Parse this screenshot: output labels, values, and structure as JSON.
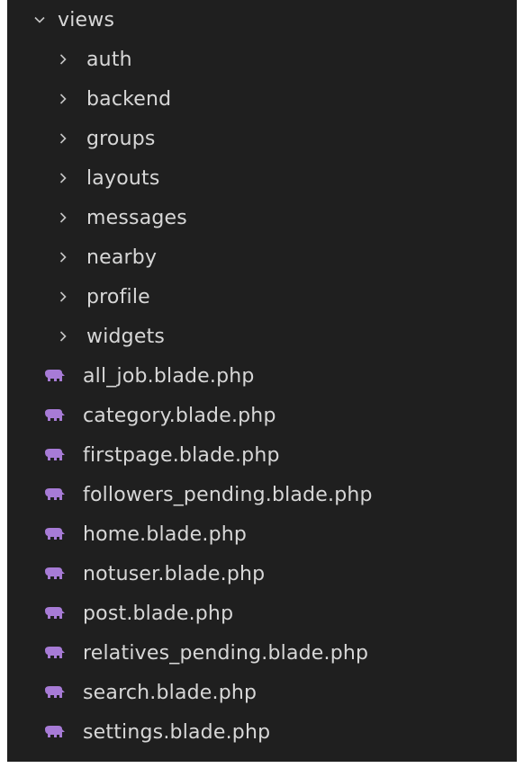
{
  "explorer": {
    "root_folder": {
      "label": "views",
      "icon": "chevron-down-icon"
    },
    "folders": [
      {
        "label": "auth",
        "icon": "chevron-right-icon"
      },
      {
        "label": "backend",
        "icon": "chevron-right-icon"
      },
      {
        "label": "groups",
        "icon": "chevron-right-icon"
      },
      {
        "label": "layouts",
        "icon": "chevron-right-icon"
      },
      {
        "label": "messages",
        "icon": "chevron-right-icon"
      },
      {
        "label": "nearby",
        "icon": "chevron-right-icon"
      },
      {
        "label": "profile",
        "icon": "chevron-right-icon"
      },
      {
        "label": "widgets",
        "icon": "chevron-right-icon"
      }
    ],
    "files": [
      {
        "label": "all_job.blade.php",
        "icon": "php-elephant-icon"
      },
      {
        "label": "category.blade.php",
        "icon": "php-elephant-icon"
      },
      {
        "label": "firstpage.blade.php",
        "icon": "php-elephant-icon"
      },
      {
        "label": "followers_pending.blade.php",
        "icon": "php-elephant-icon"
      },
      {
        "label": "home.blade.php",
        "icon": "php-elephant-icon"
      },
      {
        "label": "notuser.blade.php",
        "icon": "php-elephant-icon"
      },
      {
        "label": "post.blade.php",
        "icon": "php-elephant-icon"
      },
      {
        "label": "relatives_pending.blade.php",
        "icon": "php-elephant-icon"
      },
      {
        "label": "search.blade.php",
        "icon": "php-elephant-icon"
      },
      {
        "label": "settings.blade.php",
        "icon": "php-elephant-icon"
      }
    ],
    "colors": {
      "background": "#1f1f1f",
      "text": "#d7d7d7",
      "chevron": "#c5c5c5",
      "php_icon": "#a77bd6"
    }
  }
}
